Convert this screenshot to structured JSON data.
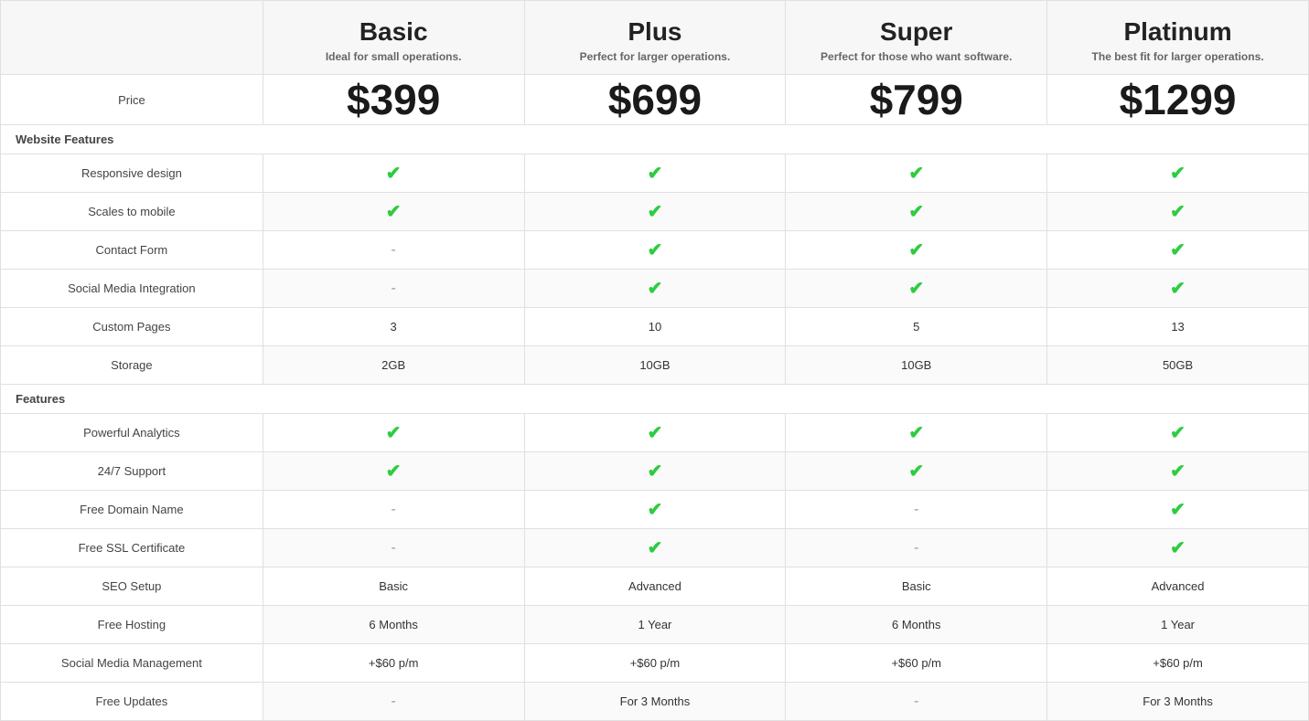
{
  "plans": [
    {
      "name": "Basic",
      "description": "Ideal for small operations.",
      "price": "$399"
    },
    {
      "name": "Plus",
      "description": "Perfect for larger operations.",
      "price": "$699"
    },
    {
      "name": "Super",
      "description": "Perfect for those who want software.",
      "price": "$799"
    },
    {
      "name": "Platinum",
      "description": "The best fit for larger operations.",
      "price": "$1299"
    }
  ],
  "sections": [
    {
      "title": "Website Features",
      "rows": [
        {
          "label": "Responsive design",
          "values": [
            "check",
            "check",
            "check",
            "check"
          ]
        },
        {
          "label": "Scales to mobile",
          "values": [
            "check",
            "check",
            "check",
            "check"
          ]
        },
        {
          "label": "Contact Form",
          "values": [
            "dash",
            "check",
            "check",
            "check"
          ]
        },
        {
          "label": "Social Media Integration",
          "values": [
            "dash",
            "check",
            "check",
            "check"
          ]
        },
        {
          "label": "Custom Pages",
          "values": [
            "3",
            "10",
            "5",
            "13"
          ]
        },
        {
          "label": "Storage",
          "values": [
            "2GB",
            "10GB",
            "10GB",
            "50GB"
          ]
        }
      ]
    },
    {
      "title": "Features",
      "rows": [
        {
          "label": "Powerful Analytics",
          "values": [
            "check",
            "check",
            "check",
            "check"
          ]
        },
        {
          "label": "24/7 Support",
          "values": [
            "check",
            "check",
            "check",
            "check"
          ]
        },
        {
          "label": "Free Domain Name",
          "values": [
            "dash",
            "check",
            "dash",
            "check"
          ]
        },
        {
          "label": "Free SSL Certificate",
          "values": [
            "dash",
            "check",
            "dash",
            "check"
          ]
        },
        {
          "label": "SEO Setup",
          "values": [
            "Basic",
            "Advanced",
            "Basic",
            "Advanced"
          ]
        },
        {
          "label": "Free Hosting",
          "values": [
            "6 Months",
            "1 Year",
            "6 Months",
            "1 Year"
          ]
        },
        {
          "label": "Social Media Management",
          "values": [
            "+$60 p/m",
            "+$60 p/m",
            "+$60 p/m",
            "+$60 p/m"
          ]
        },
        {
          "label": "Free Updates",
          "values": [
            "dash",
            "For 3 Months",
            "dash",
            "For 3 Months"
          ]
        }
      ]
    }
  ]
}
